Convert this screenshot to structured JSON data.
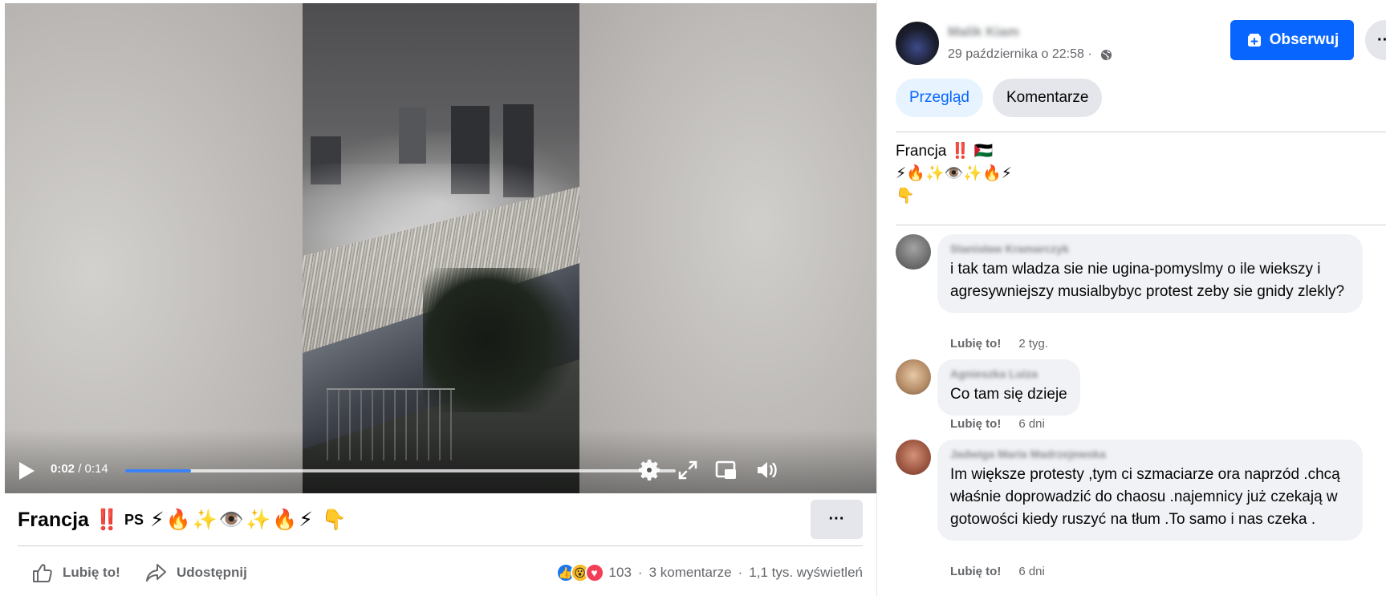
{
  "video": {
    "time_current": "0:02",
    "time_separator": " / ",
    "time_total": "0:14",
    "progress_fraction": 0.12,
    "progress_color": "#3b82f6"
  },
  "post": {
    "title": "Francja ‼️",
    "title_ps": "PS",
    "title_emojis": "⚡🔥✨👁️✨🔥⚡ 👇",
    "more_label": "···",
    "actions": {
      "like_label": "Lubię to!",
      "share_label": "Udostępnij"
    },
    "stats": {
      "reaction_count": "103",
      "comments": "3 komentarze",
      "views": "1,1 tys. wyświetleń"
    }
  },
  "panel": {
    "author_name": "Malik Kiam",
    "date": "29 października o 22:58",
    "date_suffix": " · ",
    "follow_label": "Obserwuj",
    "more_label": "···",
    "tabs": [
      {
        "label": "Przegląd"
      },
      {
        "label": "Komentarze"
      }
    ],
    "post_text": {
      "line1": "Francja ‼️ 🇵🇸",
      "line2": "⚡🔥✨👁️✨🔥⚡",
      "line3": "👇"
    },
    "comments": [
      {
        "author": "Stanisław Kramarczyk",
        "text": "i tak tam wladza sie nie ugina-pomyslmy o ile wiekszy i agresywniejszy musialbybyc protest zeby sie gnidy zlekly?",
        "like_label": "Lubię to!",
        "time": "2 tyg."
      },
      {
        "author": "Agnieszka Luiza",
        "text": "Co tam się dzieje",
        "like_label": "Lubię to!",
        "time": "6 dni"
      },
      {
        "author": "Jadwiga Maria Madrzejewska",
        "text": "Im większe protesty ,tym ci szmaciarze ora naprzód .chcą właśnie doprowadzić do chaosu .najemnicy już czekają w gotowości kiedy ruszyć na tłum .To samo i nas czeka .",
        "like_label": "Lubię to!",
        "time": "6 dni"
      }
    ]
  },
  "colors": {
    "brand": "#0866ff",
    "secondary_text": "#65676b",
    "bubble": "#f0f2f5"
  }
}
